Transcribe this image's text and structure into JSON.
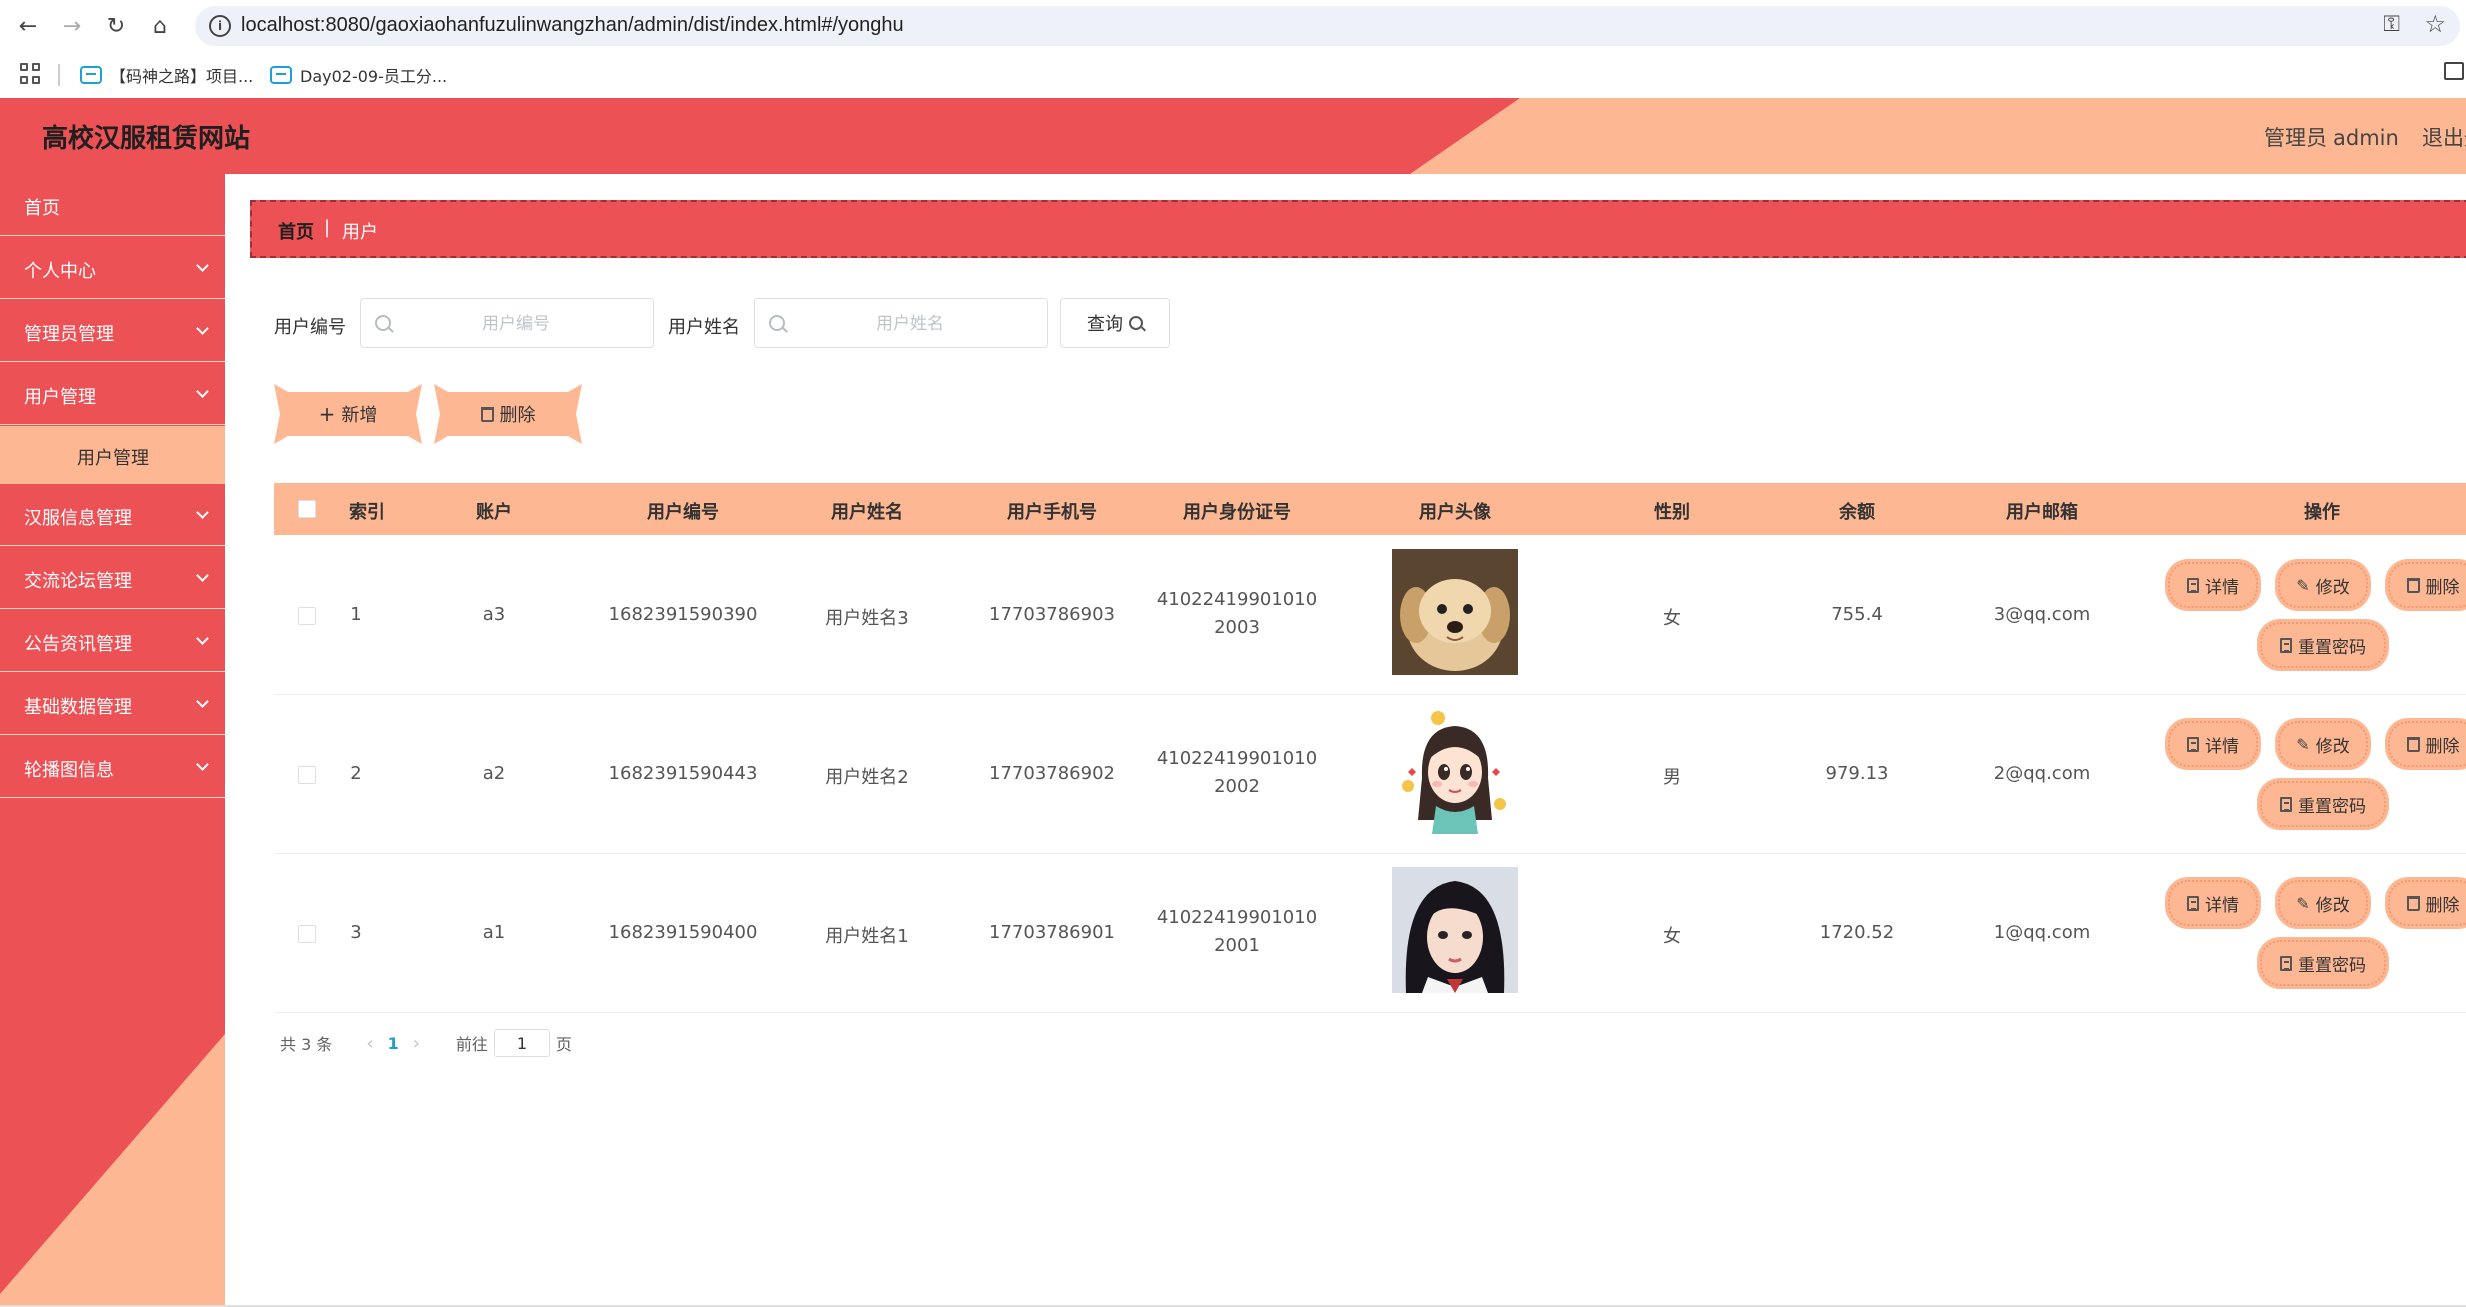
{
  "browser": {
    "url": "localhost:8080/gaoxiaohanfuzulinwangzhan/admin/dist/index.html#/yonghu",
    "bookmarks": [
      {
        "label": "【码神之路】项目..."
      },
      {
        "label": "Day02-09-员工分..."
      }
    ]
  },
  "header": {
    "title": "高校汉服租赁网站",
    "user_label": "管理员",
    "username": "admin",
    "logout": "退出登"
  },
  "sidebar": {
    "items": [
      {
        "label": "首页"
      },
      {
        "label": "个人中心"
      },
      {
        "label": "管理员管理"
      },
      {
        "label": "用户管理"
      },
      {
        "label": "汉服信息管理"
      },
      {
        "label": "交流论坛管理"
      },
      {
        "label": "公告资讯管理"
      },
      {
        "label": "基础数据管理"
      },
      {
        "label": "轮播图信息"
      }
    ],
    "active_sub": {
      "label": "用户管理"
    }
  },
  "breadcrumb": {
    "home": "首页",
    "separator": "|",
    "current": "用户"
  },
  "search": {
    "field1_label": "用户编号",
    "field1_placeholder": "用户编号",
    "field1_value": "",
    "field2_label": "用户姓名",
    "field2_placeholder": "用户姓名",
    "field2_value": "",
    "query_label": "查询"
  },
  "actions": {
    "add_label": "新增",
    "delete_label": "删除"
  },
  "table": {
    "columns": [
      "索引",
      "账户",
      "用户编号",
      "用户姓名",
      "用户手机号",
      "用户身份证号",
      "用户头像",
      "性别",
      "余额",
      "用户邮箱",
      "操作"
    ],
    "rows": [
      {
        "index": "1",
        "account": "a3",
        "user_no": "1682391590390",
        "name": "用户姓名3",
        "phone": "17703786903",
        "id_card": "410224199010102003",
        "gender": "女",
        "balance": "755.4",
        "email": "3@qq.com",
        "avatar": "puppy-avatar"
      },
      {
        "index": "2",
        "account": "a2",
        "user_no": "1682391590443",
        "name": "用户姓名2",
        "phone": "17703786902",
        "id_card": "410224199010102002",
        "gender": "男",
        "balance": "979.13",
        "email": "2@qq.com",
        "avatar": "cartoon-girl-avatar"
      },
      {
        "index": "3",
        "account": "a1",
        "user_no": "1682391590400",
        "name": "用户姓名1",
        "phone": "17703786901",
        "id_card": "410224199010102001",
        "gender": "女",
        "balance": "1720.52",
        "email": "1@qq.com",
        "avatar": "photo-girl-avatar"
      }
    ],
    "op_labels": {
      "detail": "详情",
      "edit": "修改",
      "delete": "删除",
      "reset": "重置密码"
    }
  },
  "pagination": {
    "total_text": "共 3 条",
    "current_page": "1",
    "goto_prefix": "前往",
    "goto_value": "1",
    "goto_suffix": "页"
  },
  "colors": {
    "primary": "#ec5156",
    "accent": "#fdb793",
    "link": "#20a0c8"
  }
}
